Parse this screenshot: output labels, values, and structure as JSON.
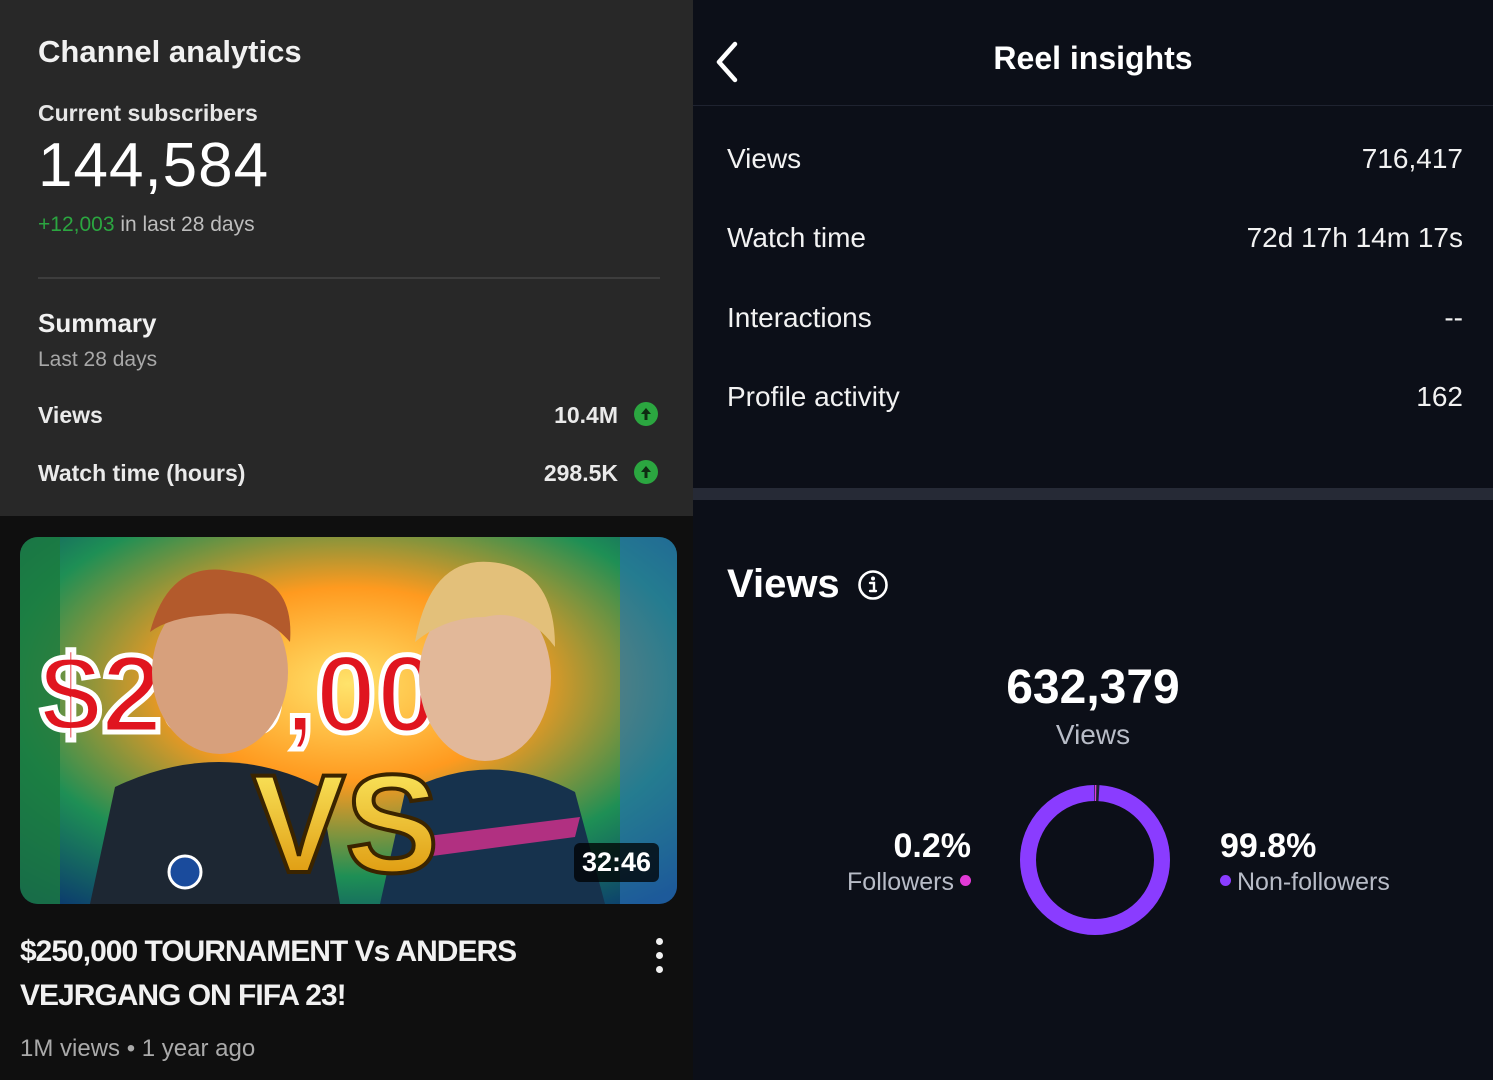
{
  "youtube": {
    "title": "Channel analytics",
    "subscribers_label": "Current subscribers",
    "subscribers_count": "144,584",
    "subscribers_delta": "+12,003",
    "subscribers_delta_suffix": " in last 28 days",
    "summary_title": "Summary",
    "summary_period": "Last 28 days",
    "metrics": [
      {
        "label": "Views",
        "value": "10.4M",
        "trend": "up"
      },
      {
        "label": "Watch time (hours)",
        "value": "298.5K",
        "trend": "up"
      }
    ],
    "video": {
      "duration": "32:46",
      "title": "$250,000 TOURNAMENT Vs ANDERS VEJRGANG ON FIFA 23!",
      "meta": "1M views • 1 year ago",
      "thumbnail_text_top": "$250,000",
      "thumbnail_text_vs": "VS"
    },
    "colors": {
      "positive": "#2ba640",
      "card": "#282828"
    }
  },
  "reel": {
    "title": "Reel insights",
    "rows": [
      {
        "label": "Views",
        "value": "716,417"
      },
      {
        "label": "Watch time",
        "value": "72d 17h 14m 17s"
      },
      {
        "label": "Interactions",
        "value": "--"
      },
      {
        "label": "Profile activity",
        "value": "162"
      }
    ],
    "views_heading": "Views",
    "views_total": "632,379",
    "views_total_label": "Views",
    "followers": {
      "pct": "0.2%",
      "label": "Followers",
      "fraction": 0.002,
      "color": "#e23ad6"
    },
    "non_followers": {
      "pct": "99.8%",
      "label": "Non-followers",
      "fraction": 0.998,
      "color": "#8a3cff"
    }
  }
}
